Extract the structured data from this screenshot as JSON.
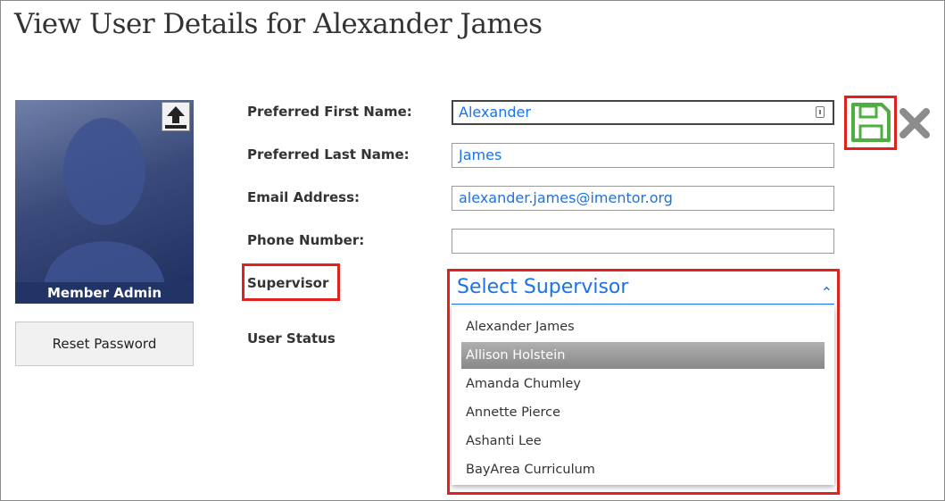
{
  "page": {
    "title": "View User Details for Alexander James"
  },
  "profile": {
    "role_label": "Member Admin",
    "reset_password": "Reset Password"
  },
  "form": {
    "first_name": {
      "label": "Preferred First Name:",
      "value": "Alexander"
    },
    "last_name": {
      "label": "Preferred Last Name:",
      "value": "James"
    },
    "email": {
      "label": "Email Address:",
      "value": "alexander.james@imentor.org"
    },
    "phone": {
      "label": "Phone Number:",
      "value": ""
    },
    "supervisor": {
      "label": "Supervisor",
      "placeholder": "Select Supervisor",
      "options": [
        "Alexander James",
        "Allison Holstein",
        "Amanda Chumley",
        "Annette Pierce",
        "Ashanti Lee",
        "BayArea Curriculum"
      ],
      "highlighted": "Allison Holstein"
    },
    "user_status": {
      "label": "User Status"
    }
  },
  "colors": {
    "accent": "#1a73e8",
    "annotation": "#e0221f",
    "save": "#4caf3f",
    "nav": "#223366"
  },
  "icons": [
    "upload-icon",
    "key-icon",
    "save-icon",
    "close-icon",
    "chevron-up-icon"
  ]
}
